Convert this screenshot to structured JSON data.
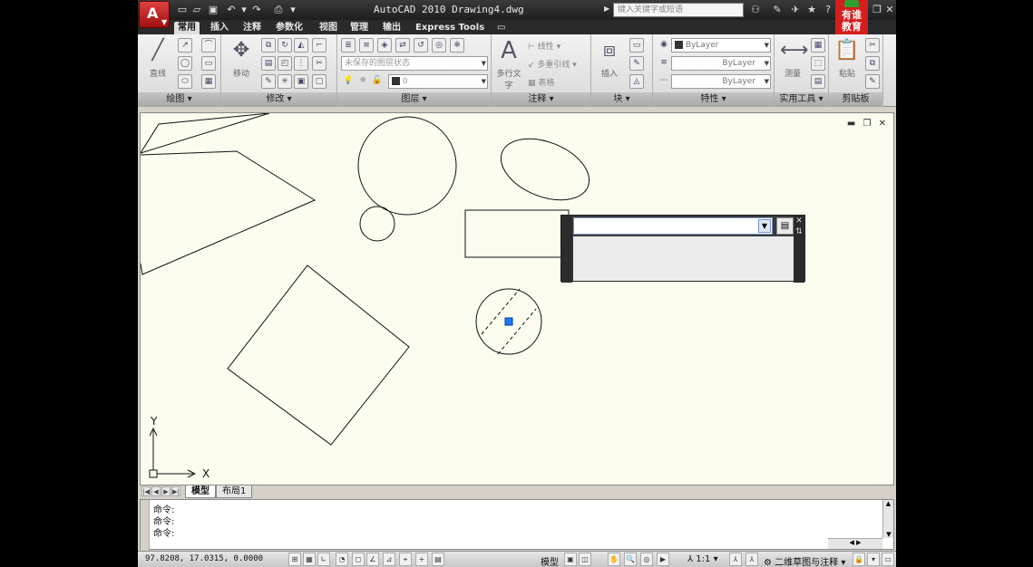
{
  "titlebar": {
    "title": "AutoCAD 2010  Drawing4.dwg",
    "search_placeholder": "键入关键字或短语",
    "brand_line1": "有谁",
    "brand_line2": "教育"
  },
  "tabs": [
    {
      "label": "常用",
      "active": true
    },
    {
      "label": "插入"
    },
    {
      "label": "注释"
    },
    {
      "label": "参数化"
    },
    {
      "label": "视图"
    },
    {
      "label": "管理"
    },
    {
      "label": "输出"
    },
    {
      "label": "Express Tools"
    }
  ],
  "ribbon": {
    "draw": {
      "title": "绘图",
      "line_label": "直线"
    },
    "modify": {
      "title": "修改",
      "move_label": "移动"
    },
    "layers": {
      "title": "图层",
      "layer_state": "未保存的图层状态",
      "layer_current": "0"
    },
    "annotation": {
      "title": "注释",
      "text_label": "多行文字",
      "linear_label": "线性",
      "mleader_label": "多重引线",
      "table_label": "表格"
    },
    "block": {
      "title": "块",
      "insert_label": "插入"
    },
    "properties": {
      "title": "特性",
      "color": "ByLayer",
      "linetype": "ByLayer",
      "lineweight": "ByLayer"
    },
    "utilities": {
      "title": "实用工具",
      "measure_label": "测量"
    },
    "clipboard": {
      "title": "剪贴板",
      "paste_label": "粘贴"
    }
  },
  "drawing": {
    "ucs_x": "X",
    "ucs_y": "Y"
  },
  "layout_tabs": [
    {
      "label": "模型",
      "active": true
    },
    {
      "label": "布局1"
    }
  ],
  "command_lines": [
    "命令:",
    "命令:",
    "命令:"
  ],
  "status": {
    "coords": "97.8208,  17.0315, 0.0000",
    "model_label": "模型",
    "scale_label": "1:1",
    "workspace_label": "二维草图与注释"
  }
}
